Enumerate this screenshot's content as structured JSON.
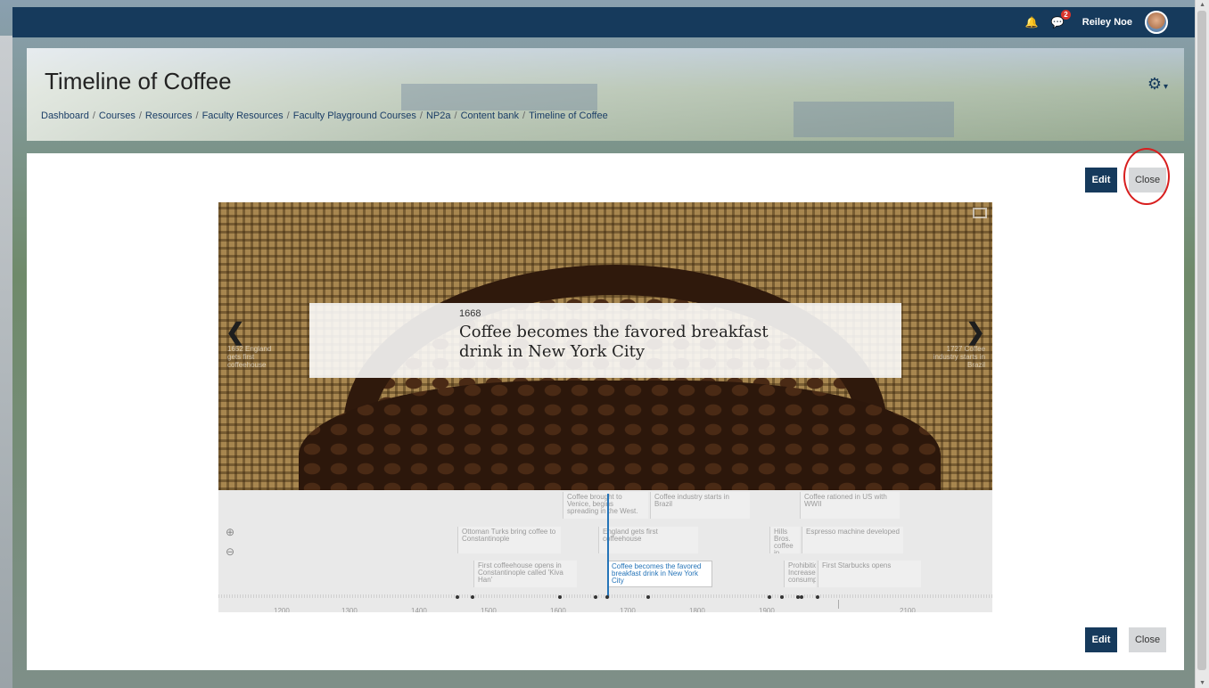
{
  "user": {
    "name": "Reiley Noe",
    "message_count": "2"
  },
  "page": {
    "title": "Timeline of Coffee"
  },
  "breadcrumb": [
    "Dashboard",
    "Courses",
    "Resources",
    "Faculty Resources",
    "Faculty Playground Courses",
    "NP2a",
    "Content bank",
    "Timeline of Coffee"
  ],
  "buttons": {
    "edit": "Edit",
    "close": "Close"
  },
  "slide": {
    "year": "1668",
    "headline": "Coffee becomes the favored breakfast drink in New York City",
    "prev_ghost": "1652 England gets first coffeehouse",
    "next_ghost": "1727 Coffee industry starts in Brazil"
  },
  "markers": [
    {
      "text": "Coffee brought to Venice, begins spreading in the West.",
      "active": false
    },
    {
      "text": "Coffee industry starts in Brazil",
      "active": false
    },
    {
      "text": "Coffee rationed in US with WWII",
      "active": false
    },
    {
      "text": "Ottoman Turks bring coffee to Constantinople",
      "active": false
    },
    {
      "text": "England gets first coffeehouse",
      "active": false
    },
    {
      "text": "Hills Bros. coffee in cans",
      "active": false
    },
    {
      "text": "Espresso machine developed",
      "active": false
    },
    {
      "text": "First coffeehouse opens in Constantinople called 'Kiva Han'",
      "active": false
    },
    {
      "text": "Coffee becomes the favored breakfast drink in New York City",
      "active": true
    },
    {
      "text": "Prohibition: Increase consumption",
      "active": false
    },
    {
      "text": "First Starbucks opens",
      "active": false
    }
  ],
  "axis": {
    "ticks": [
      "1200",
      "1300",
      "1400",
      "1500",
      "1600",
      "1700",
      "1800",
      "1900",
      "2100"
    ],
    "major": "2000"
  },
  "icons": [
    "bell-icon",
    "chat-icon",
    "gear-icon",
    "zoom-in-icon",
    "zoom-out-icon",
    "chevron-left-icon",
    "chevron-right-icon",
    "fullscreen-icon"
  ]
}
